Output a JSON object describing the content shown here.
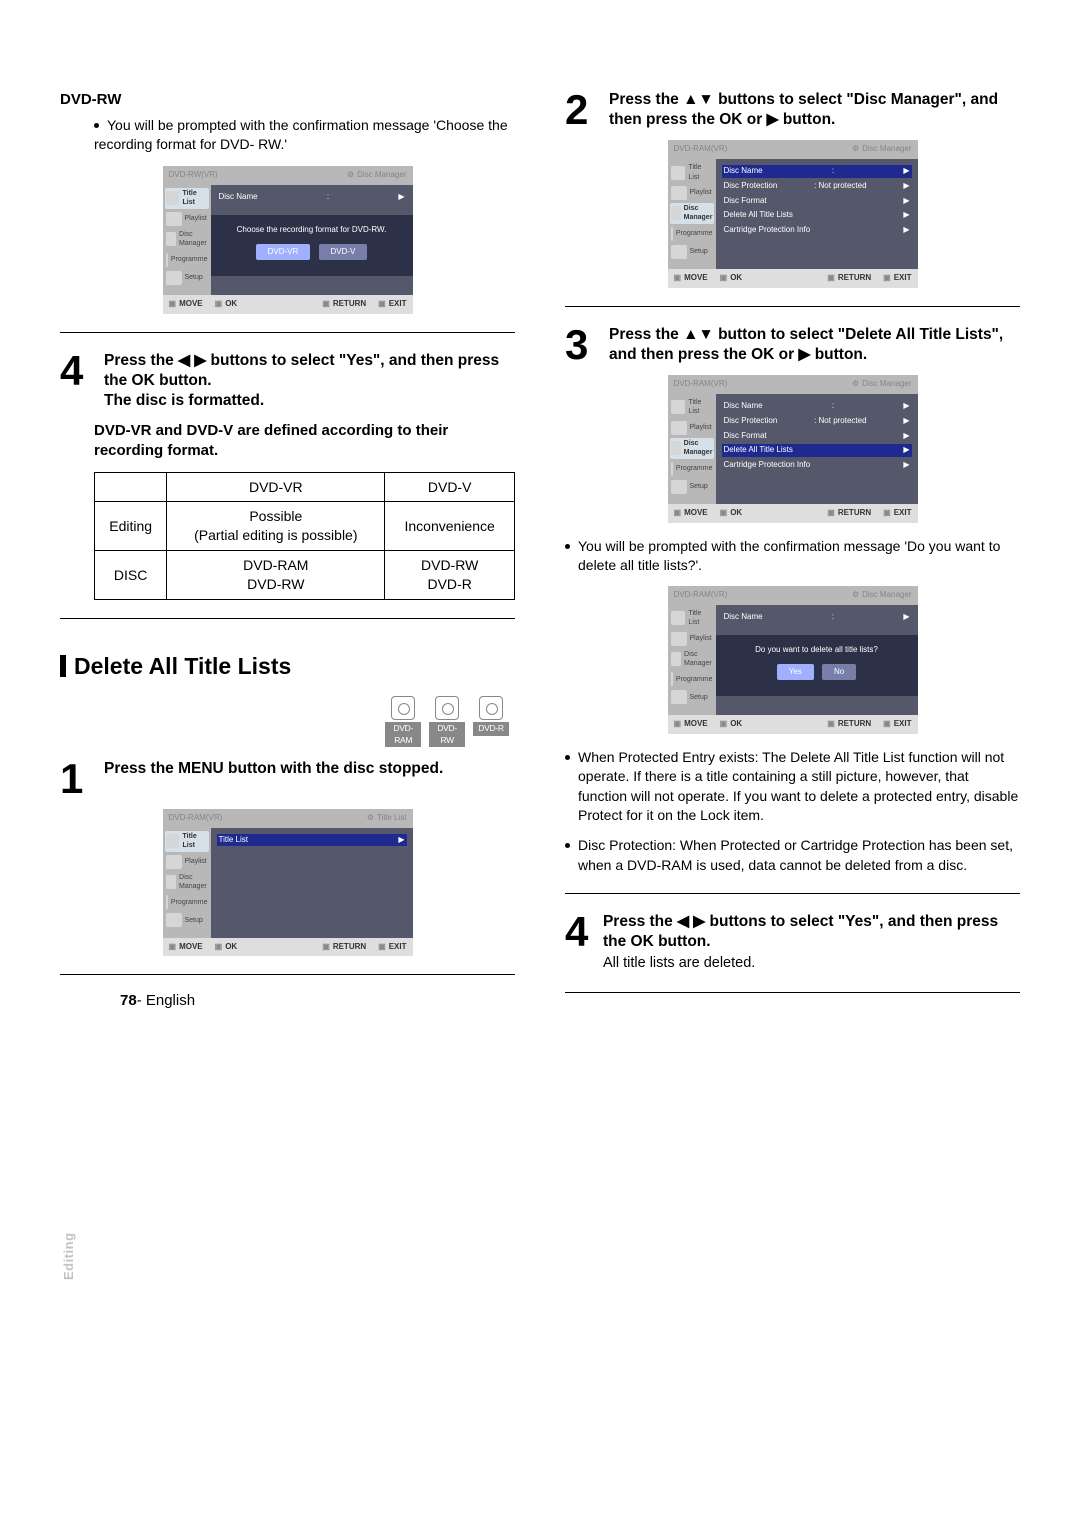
{
  "left": {
    "dvd_rw_label": "DVD-RW",
    "prompt_text": "You will be prompted with the confirmation message 'Choose the recording format for DVD- RW.'",
    "step4_text": "Press the ◀ ▶ buttons to select \"Yes\", and then press the OK button.\nThe disc is formatted.",
    "defined_text": "DVD-VR and DVD-V are defined according to their recording format.",
    "table": {
      "h1": "DVD-VR",
      "h2": "DVD-V",
      "r1c0": "Editing",
      "r1c1": "Possible\n(Partial editing is possible)",
      "r1c2": "Inconvenience",
      "r2c0": "DISC",
      "r2c1": "DVD-RAM\nDVD-RW",
      "r2c2": "DVD-RW\nDVD-R"
    },
    "section_title": "Delete All Title Lists",
    "discs": {
      "a": "DVD-RAM",
      "b": "DVD-RW",
      "c": "DVD-R"
    },
    "step1_text": "Press the MENU button with the disc stopped."
  },
  "right": {
    "step2_text": "Press the ▲▼ buttons to select \"Disc Manager\", and then press the OK or ▶ button.",
    "step3_text": "Press the ▲▼ button to select \"Delete All Title Lists\",  and then press the OK or ▶ button.",
    "confirm_text": "You will be prompted with the confirmation message 'Do you want to delete all title lists?'.",
    "note1": "When Protected Entry exists: The Delete All Title List function will not operate. If there is a title containing a still picture, however, that function will not operate. If you want to delete a protected entry, disable Protect for it on the Lock item.",
    "note2": "Disc Protection: When Protected or Cartridge Protection has been set, when a DVD-RAM is used, data cannot be deleted from a disc.",
    "step4_text": "Press the ◀ ▶ buttons to select \"Yes\", and then press the OK button.",
    "step4_sub": "All title lists are deleted."
  },
  "shot": {
    "nav": {
      "title_list": "Title List",
      "playlist": "Playlist",
      "disc_manager": "Disc Manager",
      "programme": "Programme",
      "setup": "Setup"
    },
    "head_rw": "DVD-RW(VR)",
    "head_ram": "DVD-RAM(VR)",
    "gear_title": "Title List",
    "gear_disc": "Disc Manager",
    "menu": {
      "disc_name": "Disc Name",
      "disc_protection": "Disc Protection",
      "not_protected": ": Not protected",
      "disc_format": "Disc Format",
      "delete_all": "Delete All Title Lists",
      "cartridge": "Cartridge Protection Info"
    },
    "prompt_format": "Choose the recording format for DVD-RW.",
    "btn_dvdvr": "DVD-VR",
    "btn_dvdv": "DVD-V",
    "prompt_delete": "Do you want to delete all title lists?",
    "btn_yes": "Yes",
    "btn_no": "No",
    "title_list_label": "Title List",
    "foot": {
      "move": "MOVE",
      "ok": "OK",
      "return": "RETURN",
      "exit": "EXIT"
    },
    "colon": ":"
  },
  "nums": {
    "n1": "1",
    "n2": "2",
    "n3": "3",
    "n4": "4"
  },
  "side_tab": "Editing",
  "page_no": "78",
  "page_lang": "- English"
}
